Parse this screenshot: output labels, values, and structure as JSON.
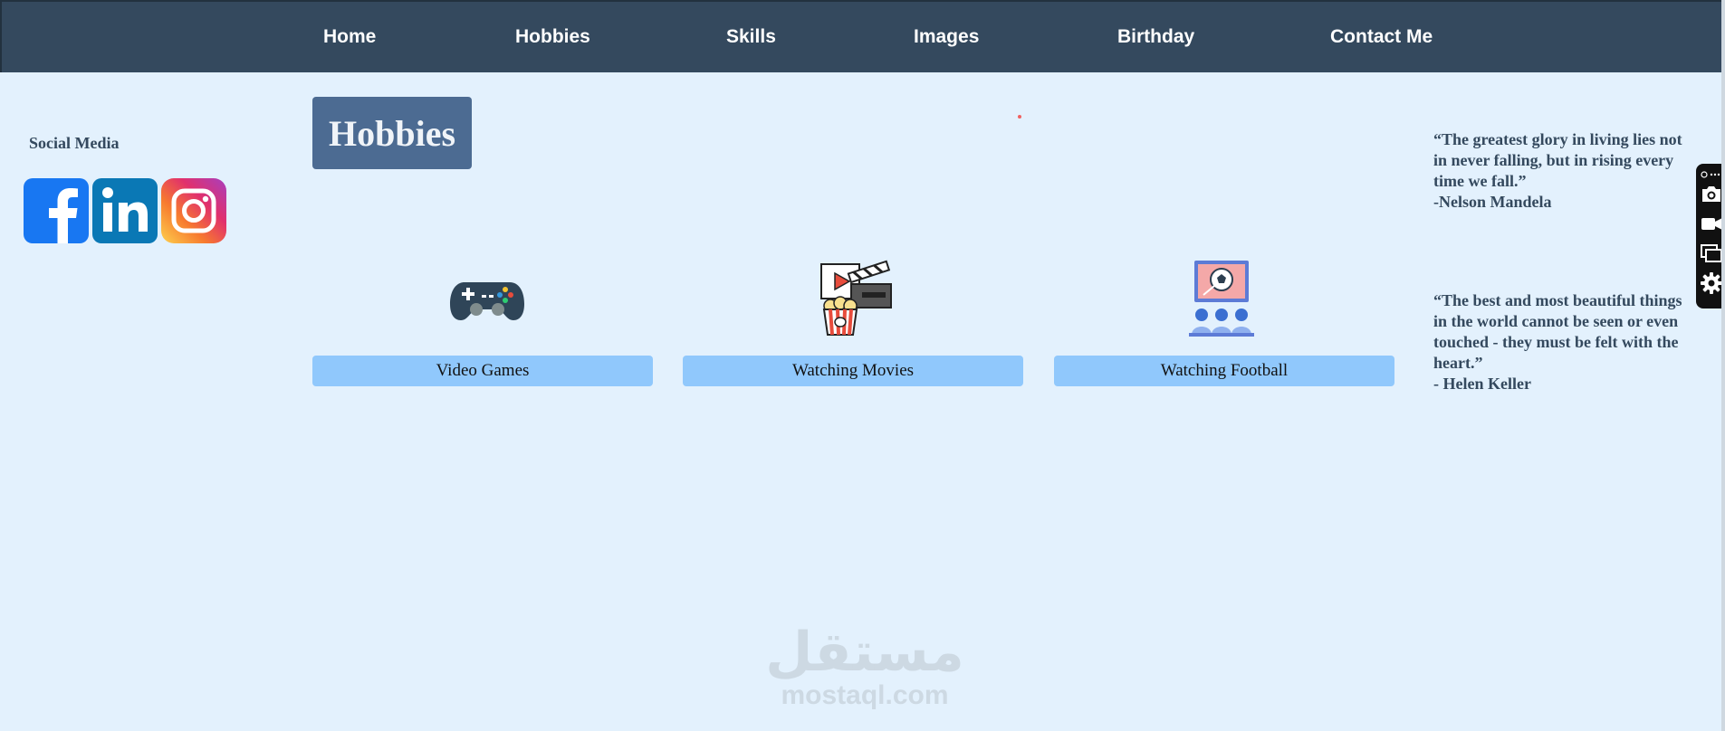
{
  "nav": {
    "items": [
      {
        "label": "Home"
      },
      {
        "label": "Hobbies"
      },
      {
        "label": "Skills"
      },
      {
        "label": "Images"
      },
      {
        "label": "Birthday"
      },
      {
        "label": "Contact Me"
      }
    ]
  },
  "social": {
    "heading": "Social Media",
    "icons": [
      "facebook-icon",
      "linkedin-icon",
      "instagram-icon"
    ]
  },
  "page": {
    "title": "Hobbies"
  },
  "hobbies": [
    {
      "label": "Video Games",
      "icon": "gamepad-icon"
    },
    {
      "label": "Watching Movies",
      "icon": "movie-popcorn-icon"
    },
    {
      "label": "Watching Football",
      "icon": "football-screen-icon"
    }
  ],
  "quotes": [
    {
      "text": "“The greatest glory in living lies not in never falling, but in rising every time we fall.”",
      "author": "-Nelson Mandela"
    },
    {
      "text": "“The best and most beautiful things in the world cannot be seen or even touched - they must be felt with the heart.”",
      "author": "- Helen Keller"
    }
  ],
  "watermark": {
    "arabic": "مستقل",
    "latin": "mostaql.com"
  },
  "colors": {
    "navbar": "#34495e",
    "background": "#e3f1fd",
    "title_box": "#4c6b92",
    "hobby_label": "#90c8fc"
  }
}
